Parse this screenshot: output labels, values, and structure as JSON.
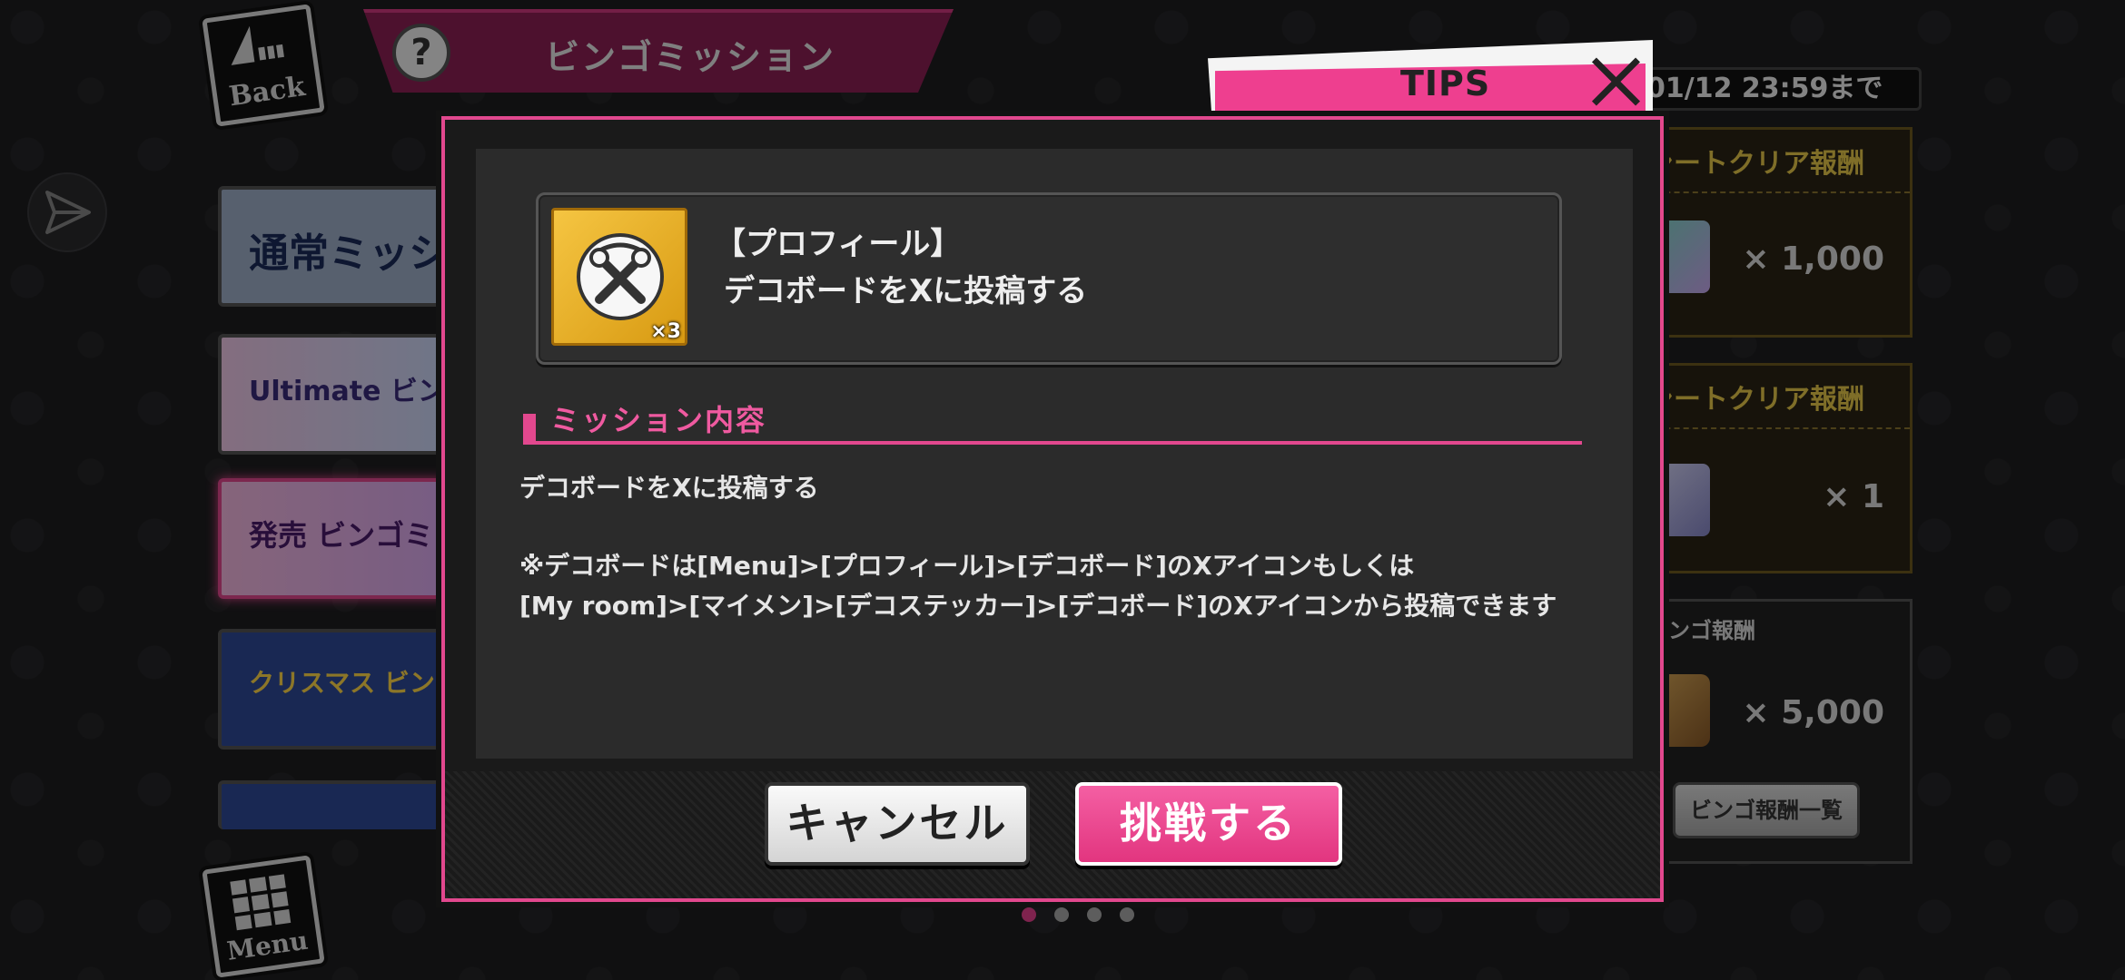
{
  "screen": {
    "back_label": "Back",
    "menu_label": "Menu",
    "title": "ビンゴミッション",
    "help_symbol": "?",
    "deadline": "01/12 23:59まで"
  },
  "tabs": [
    {
      "label": "通常ミッション",
      "color": "#9fb0c8"
    },
    {
      "label": "Ultimate ビンゴミッション",
      "color": "#d8c8f0"
    },
    {
      "label": "発売 ビンゴミ",
      "color": "#e8a8d8"
    },
    {
      "label": "クリスマス ビンゴミッション",
      "color": "#3050a0"
    },
    {
      "label": "",
      "color": "#3050a0"
    }
  ],
  "rewards": [
    {
      "head": "シートクリア報酬",
      "amount": "× 1,000"
    },
    {
      "head": "シートクリア報酬",
      "amount": "× 1"
    },
    {
      "head": "ビンゴ報酬",
      "amount": "× 5,000"
    }
  ],
  "bingo_list_button": "ビンゴ報酬一覧",
  "pager": {
    "count": 4,
    "active": 0
  },
  "modal": {
    "tab_label": "TIPS",
    "card": {
      "badge_multiplier": "×3",
      "title": "【プロフィール】",
      "description": "デコボードをXに投稿する"
    },
    "section_heading": "ミッション内容",
    "body": [
      "デコボードをXに投稿する",
      "",
      "※デコボードは[Menu]>[プロフィール]>[デコボード]のXアイコンもしくは",
      "[My room]>[マイメン]>[デコステッカー]>[デコボード]のXアイコンから投稿できます"
    ],
    "cancel_label": "キャンセル",
    "challenge_label": "挑戦する"
  },
  "colors": {
    "accent_pink": "#e2488e",
    "badge_gold": "#f5c542",
    "panel_bg": "#2b2b2b"
  }
}
